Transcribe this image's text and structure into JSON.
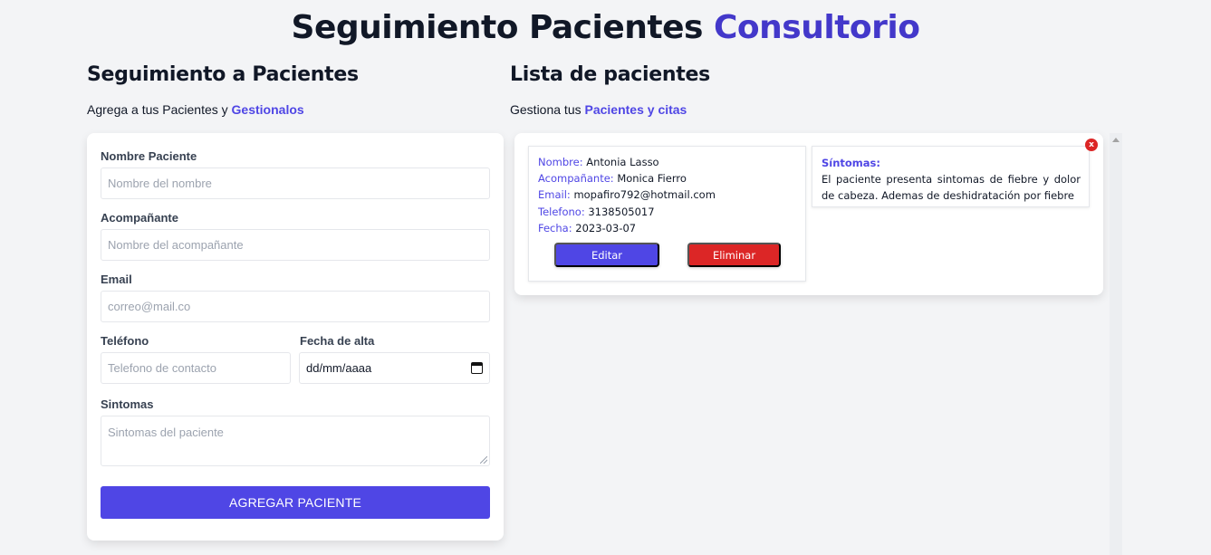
{
  "header": {
    "title_main": "Seguimiento Pacientes",
    "title_accent": "Consultorio"
  },
  "form_section": {
    "title": "Seguimiento a Pacientes",
    "subtitle_text": "Agrega a tus Pacientes y",
    "subtitle_accent": "Gestionalos",
    "fields": {
      "name": {
        "label": "Nombre Paciente",
        "placeholder": "Nombre del nombre",
        "value": ""
      },
      "companion": {
        "label": "Acompañante",
        "placeholder": "Nombre del acompañante",
        "value": ""
      },
      "email": {
        "label": "Email",
        "placeholder": "correo@mail.co",
        "value": ""
      },
      "phone": {
        "label": "Teléfono",
        "placeholder": "Telefono de contacto",
        "value": ""
      },
      "date": {
        "label": "Fecha de alta",
        "placeholder": "dd/mm/aaaa"
      },
      "symptoms": {
        "label": "Sintomas",
        "placeholder": "Sintomas del paciente",
        "value": ""
      }
    },
    "submit_label": "AGREGAR PACIENTE"
  },
  "list_section": {
    "title": "Lista de pacientes",
    "subtitle_text": "Gestiona tus",
    "subtitle_accent": "Pacientes y citas",
    "patients": [
      {
        "name_label": "Nombre:",
        "name": "Antonia Lasso",
        "companion_label": "Acompañante:",
        "companion": "Monica Fierro",
        "email_label": "Email:",
        "email": "mopafiro792@hotmail.com",
        "phone_label": "Telefono:",
        "phone": "3138505017",
        "date_label": "Fecha:",
        "date": "2023-03-07",
        "symptoms_label": "Síntomas:",
        "symptoms": "El paciente presenta sintomas de fiebre y dolor de cabeza. Ademas de deshidratación por fiebre",
        "edit_label": "Editar",
        "delete_label": "Eliminar",
        "close_label": "x"
      }
    ]
  },
  "colors": {
    "accent": "#4f46e5",
    "title_accent": "#4338ca",
    "danger": "#dc2626",
    "background": "#f3f4f6"
  },
  "icons": [
    "calendar-icon",
    "resize-handle-icon",
    "close-icon",
    "scroll-up-arrow-icon"
  ]
}
